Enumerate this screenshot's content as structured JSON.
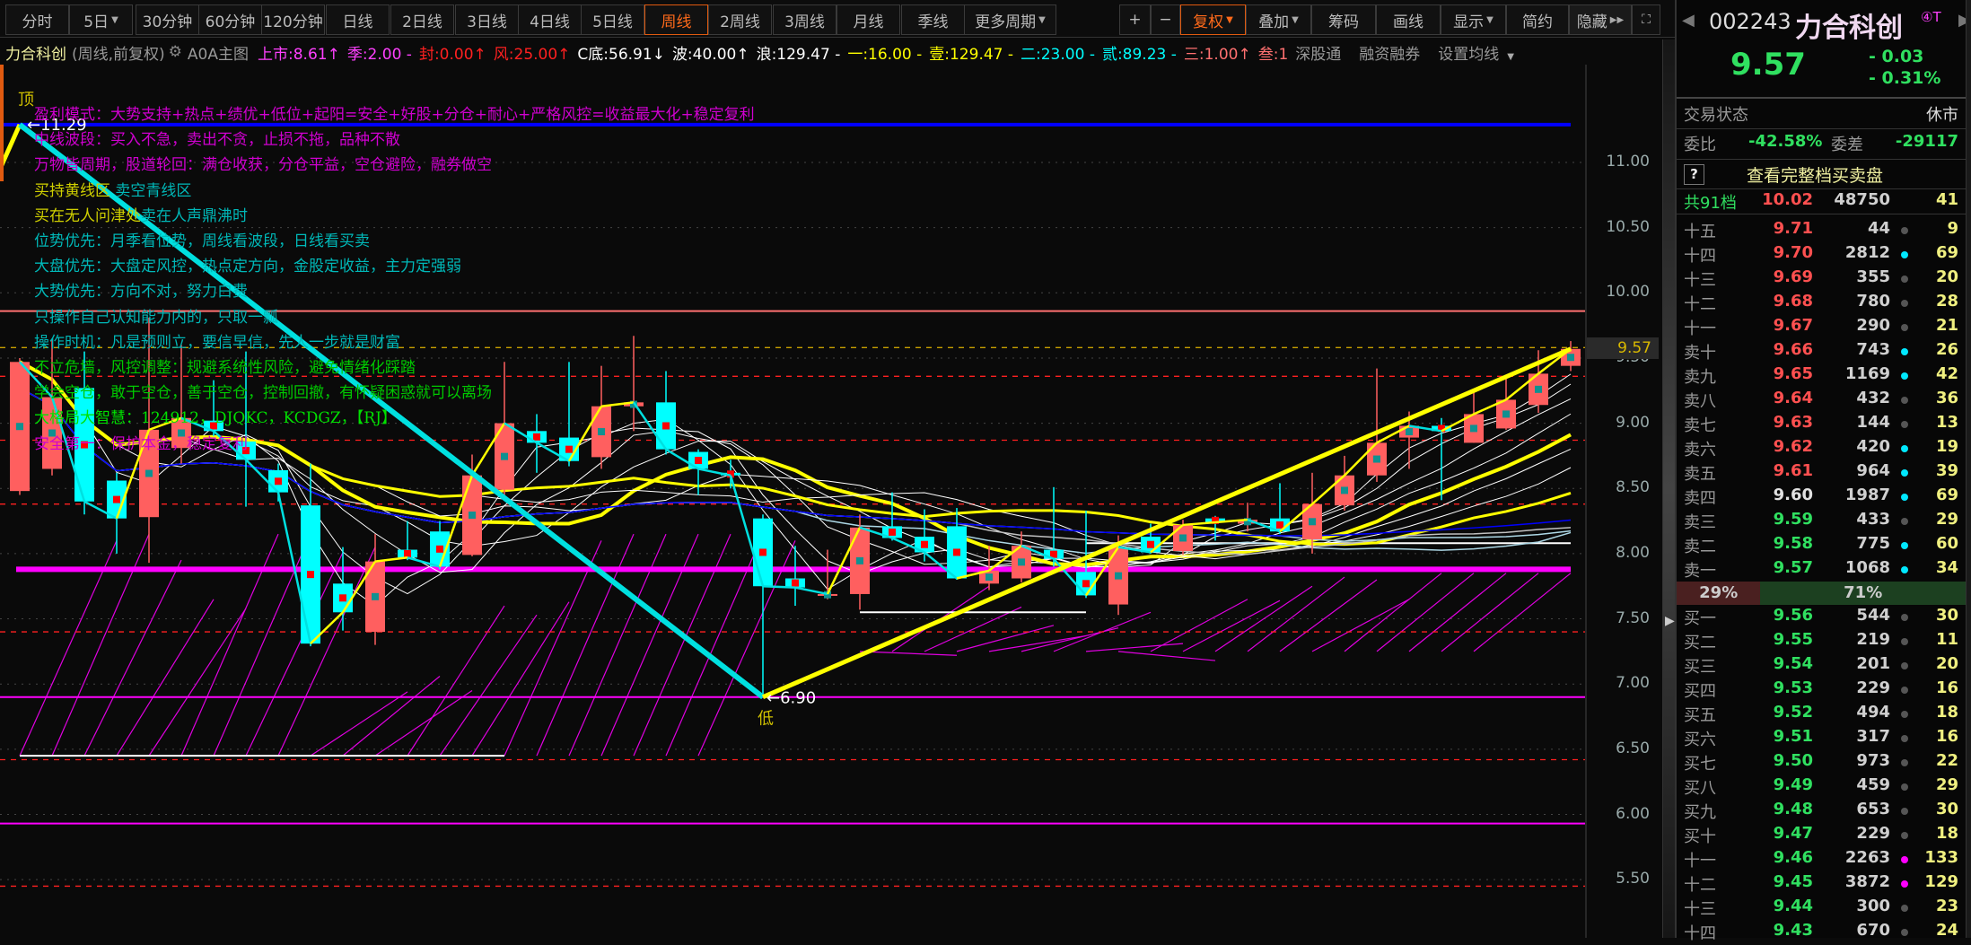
{
  "toolbar": {
    "periods": [
      "分时",
      "5日",
      "30分钟",
      "60分钟",
      "120分钟",
      "日线",
      "2日线",
      "3日线",
      "4日线",
      "5日线",
      "周线",
      "2周线",
      "3周线",
      "月线",
      "季线",
      "更多周期"
    ],
    "active_period": "周线",
    "plus": "+",
    "minus": "−",
    "fuquan": "复权",
    "diejia": "叠加",
    "chouma": "筹码",
    "huaxian": "画线",
    "xianshi": "显示",
    "jianyue": "简约",
    "yincang": "隐藏"
  },
  "info": {
    "name": "力合科创",
    "mode": "(周线,前复权)",
    "main": "A0A主图",
    "items": [
      {
        "text": "上市:8.61↑",
        "color": "#ff40ff"
      },
      {
        "text": "季:2.00 -",
        "color": "#ff40ff"
      },
      {
        "text": "封:0.00↑",
        "color": "#ff2020"
      },
      {
        "text": "风:25.00↑",
        "color": "#ff2020"
      },
      {
        "text": "C底:56.91↓",
        "color": "#ffffff"
      },
      {
        "text": "波:40.00↑",
        "color": "#ffffff"
      },
      {
        "text": "浪:129.47 -",
        "color": "#ffffff"
      },
      {
        "text": "一:16.00 -",
        "color": "#ffff00"
      },
      {
        "text": "壹:129.47 -",
        "color": "#ffff00"
      },
      {
        "text": "二:23.00 -",
        "color": "#00ffff"
      },
      {
        "text": "贰:89.23 -",
        "color": "#00ffff"
      },
      {
        "text": "三:1.00↑",
        "color": "#ff7070"
      },
      {
        "text": "叁:1",
        "color": "#ff7070"
      }
    ],
    "sgt": "深股通",
    "rzrq": "融资融券",
    "ma_setting": "设置均线"
  },
  "annotations": [
    [
      {
        "t": "盈利模式：大势支持+热点+绩优+低位+起阳=安全+好股+分仓+耐心+严格风控=收益最大化+稳定复利",
        "c": "#d000d0"
      }
    ],
    [
      {
        "t": "中线波段：买入不急，卖出不贪，止损不拖，品种不散",
        "c": "#d000d0"
      }
    ],
    [
      {
        "t": "万物皆周期，股道轮回：满仓收获，分仓平益，空仓避险，融券做空",
        "c": "#d000d0"
      }
    ],
    [
      {
        "t": "买持黄线区 ",
        "c": "#d0d000"
      },
      {
        "t": "卖空青线区",
        "c": "#00b8b8"
      }
    ],
    [
      {
        "t": "买在无人问津处",
        "c": "#d0d000"
      },
      {
        "t": "卖在人声鼎沸时",
        "c": "#00b8b8"
      }
    ],
    [
      {
        "t": "位势优先：月季看位势，周线看波段，日线看买卖",
        "c": "#00b8b8"
      }
    ],
    [
      {
        "t": "大盘优先：大盘定风控，热点定方向，金股定收益，主力定强弱",
        "c": "#00b8b8"
      }
    ],
    [
      {
        "t": "大势优先：方向不对，努力白费",
        "c": "#00b8b8"
      }
    ],
    [
      {
        "t": "只操作自己认知能力内的，只取一瓢",
        "c": "#00b8b8"
      }
    ],
    [
      {
        "t": "操作时机：凡是预则立，要信早信，先人一步就是财富",
        "c": "#00b8b8"
      }
    ],
    [
      {
        "t": "不立危墙，风控调整：规避系统性风险，避免情绪化踩踏",
        "c": "#00c800"
      }
    ],
    [
      {
        "t": "学会空仓，敢于空仓，善于空仓，控制回撤，有怀疑困惑就可以离场",
        "c": "#00c800"
      }
    ],
    [
      {
        "t": "大格局大智慧：124912，DJQKC，KCDGZ，【RJ】",
        "c": "#00e000"
      }
    ],
    [
      {
        "t": "安全第一：保护本金，稳定复利",
        "c": "#d000d0"
      }
    ]
  ],
  "chart_data": {
    "type": "candlestick",
    "title": "力合科创(周线,前复权)",
    "ylim": [
      5.2,
      11.6
    ],
    "yticks": [
      "11.00",
      "10.50",
      "10.00",
      "9.50",
      "9.00",
      "8.50",
      "8.00",
      "7.50",
      "7.00",
      "6.50",
      "6.00",
      "5.50"
    ],
    "current_price": "9.57",
    "candles_ohlc": [
      [
        8.48,
        9.5,
        8.45,
        9.47
      ],
      [
        8.65,
        9.64,
        8.6,
        9.2
      ],
      [
        9.27,
        9.55,
        8.3,
        8.4
      ],
      [
        8.56,
        8.62,
        8.0,
        8.27
      ],
      [
        8.28,
        9.81,
        7.93,
        8.95
      ],
      [
        8.81,
        9.6,
        8.69,
        9.04
      ],
      [
        9.02,
        9.33,
        8.9,
        8.94
      ],
      [
        8.86,
        9.55,
        8.36,
        8.72
      ],
      [
        8.64,
        8.69,
        8.4,
        8.47
      ],
      [
        8.37,
        8.69,
        7.29,
        7.31
      ],
      [
        7.77,
        8.05,
        7.41,
        7.55
      ],
      [
        7.4,
        8.15,
        7.3,
        7.94
      ],
      [
        8.03,
        8.25,
        7.95,
        7.97
      ],
      [
        8.17,
        8.25,
        7.88,
        7.9
      ],
      [
        7.99,
        8.76,
        7.98,
        8.6
      ],
      [
        8.49,
        9.47,
        8.45,
        9.0
      ],
      [
        8.94,
        9.07,
        8.62,
        8.85
      ],
      [
        8.89,
        9.47,
        8.67,
        8.71
      ],
      [
        8.74,
        9.44,
        8.65,
        9.13
      ],
      [
        9.13,
        9.67,
        8.94,
        9.16
      ],
      [
        9.16,
        9.4,
        8.76,
        8.8
      ],
      [
        8.78,
        8.8,
        8.45,
        8.65
      ],
      [
        8.62,
        8.72,
        8.5,
        8.6
      ],
      [
        8.27,
        8.3,
        6.9,
        7.75
      ],
      [
        7.81,
        8.06,
        7.6,
        7.74
      ],
      [
        7.68,
        8.03,
        7.65,
        7.69
      ],
      [
        7.69,
        8.3,
        7.57,
        8.2
      ],
      [
        8.21,
        8.47,
        8.1,
        8.12
      ],
      [
        8.13,
        8.34,
        7.94,
        8.01
      ],
      [
        8.21,
        8.35,
        7.8,
        7.81
      ],
      [
        7.77,
        8.06,
        7.72,
        7.87
      ],
      [
        7.81,
        8.17,
        7.78,
        8.06
      ],
      [
        8.03,
        8.51,
        7.9,
        7.96
      ],
      [
        7.86,
        8.33,
        7.66,
        7.68
      ],
      [
        7.61,
        8.14,
        7.53,
        8.05
      ],
      [
        8.13,
        8.23,
        8.0,
        8.01
      ],
      [
        8.02,
        8.26,
        7.99,
        8.22
      ],
      [
        8.27,
        8.29,
        8.1,
        8.24
      ],
      [
        8.23,
        8.39,
        8.17,
        8.26
      ],
      [
        8.27,
        8.54,
        8.15,
        8.17
      ],
      [
        8.11,
        8.62,
        8.0,
        8.38
      ],
      [
        8.37,
        8.75,
        8.33,
        8.6
      ],
      [
        8.6,
        9.42,
        8.55,
        8.85
      ],
      [
        8.89,
        9.09,
        8.65,
        8.98
      ],
      [
        8.98,
        9.04,
        8.41,
        8.94
      ],
      [
        8.85,
        9.25,
        8.85,
        9.07
      ],
      [
        8.96,
        9.36,
        8.95,
        9.18
      ],
      [
        9.14,
        9.56,
        9.08,
        9.38
      ],
      [
        9.44,
        9.63,
        9.4,
        9.57
      ]
    ],
    "ref_lines": [
      {
        "price": 11.29,
        "color": "#0000ff",
        "style": "solid"
      },
      {
        "price": 9.86,
        "color": "#ff7070",
        "style": "solid"
      },
      {
        "price": 9.58,
        "color": "#c8a000",
        "style": "dashed"
      },
      {
        "price": 9.36,
        "color": "#ff2020",
        "style": "dashed"
      },
      {
        "price": 8.87,
        "color": "#ff2020",
        "style": "dashed"
      },
      {
        "price": 8.38,
        "color": "#ff2020",
        "style": "dashed"
      },
      {
        "price": 7.88,
        "color": "#ff00ff",
        "style": "thick"
      },
      {
        "price": 7.4,
        "color": "#ff2020",
        "style": "dashed"
      },
      {
        "price": 6.9,
        "color": "#ff00ff",
        "style": "solid"
      },
      {
        "price": 6.42,
        "color": "#ff2020",
        "style": "dashed"
      },
      {
        "price": 5.93,
        "color": "#ff00ff",
        "style": "solid"
      },
      {
        "price": 5.45,
        "color": "#ff2020",
        "style": "dashed"
      }
    ],
    "zigzag": [
      {
        "index": 0,
        "price": 11.29
      },
      {
        "index": 23,
        "price": 6.9
      },
      {
        "index": 48,
        "price": 9.57
      }
    ],
    "top_label": "顶",
    "top_value": "←11.29",
    "low_label": "低",
    "low_value": "←6.90"
  },
  "panel": {
    "code": "002243",
    "name": "力合科创",
    "badge": "④T",
    "price": "9.57",
    "change": "- 0.03",
    "pct": "- 0.31%",
    "status_label": "交易状态",
    "status_value": "休市",
    "wb_label": "委比",
    "wb_value": "-42.58%",
    "wc_label": "委差",
    "wc_value": "-29117",
    "help": "?",
    "full_book": "查看完整档买卖盘",
    "summary": {
      "label": "共91档",
      "price": "10.02",
      "vol": "48750",
      "count": "41"
    },
    "asks": [
      [
        "十五",
        "9.71",
        "44",
        "#555",
        "9"
      ],
      [
        "十四",
        "9.70",
        "2812",
        "#00e8ff",
        "69"
      ],
      [
        "十三",
        "9.69",
        "355",
        "#555",
        "20"
      ],
      [
        "十二",
        "9.68",
        "780",
        "#555",
        "28"
      ],
      [
        "十一",
        "9.67",
        "290",
        "#555",
        "21"
      ],
      [
        "卖十",
        "9.66",
        "743",
        "#00e8ff",
        "26"
      ],
      [
        "卖九",
        "9.65",
        "1169",
        "#00e8ff",
        "42"
      ],
      [
        "卖八",
        "9.64",
        "432",
        "#555",
        "36"
      ],
      [
        "卖七",
        "9.63",
        "144",
        "#555",
        "13"
      ],
      [
        "卖六",
        "9.62",
        "420",
        "#00e8ff",
        "19"
      ],
      [
        "卖五",
        "9.61",
        "964",
        "#00e8ff",
        "39"
      ],
      [
        "卖四",
        "9.60",
        "1987",
        "#00e8ff",
        "69"
      ],
      [
        "卖三",
        "9.59",
        "433",
        "#555",
        "29"
      ],
      [
        "卖二",
        "9.58",
        "775",
        "#00e8ff",
        "60"
      ],
      [
        "卖一",
        "9.57",
        "1068",
        "#00e8ff",
        "34"
      ]
    ],
    "bar": {
      "buy_pct": "29%",
      "sell_pct": "71%",
      "buy_ratio": 0.29
    },
    "bids": [
      [
        "买一",
        "9.56",
        "544",
        "#555",
        "30"
      ],
      [
        "买二",
        "9.55",
        "219",
        "#555",
        "11"
      ],
      [
        "买三",
        "9.54",
        "201",
        "#555",
        "20"
      ],
      [
        "买四",
        "9.53",
        "229",
        "#555",
        "16"
      ],
      [
        "买五",
        "9.52",
        "494",
        "#555",
        "18"
      ],
      [
        "买六",
        "9.51",
        "317",
        "#555",
        "16"
      ],
      [
        "买七",
        "9.50",
        "973",
        "#555",
        "22"
      ],
      [
        "买八",
        "9.49",
        "459",
        "#555",
        "29"
      ],
      [
        "买九",
        "9.48",
        "653",
        "#555",
        "30"
      ],
      [
        "买十",
        "9.47",
        "229",
        "#555",
        "18"
      ],
      [
        "十一",
        "9.46",
        "2263",
        "#ff00ff",
        "133"
      ],
      [
        "十二",
        "9.45",
        "3872",
        "#ff00ff",
        "129"
      ],
      [
        "十三",
        "9.44",
        "300",
        "#555",
        "23"
      ],
      [
        "十四",
        "9.43",
        "670",
        "#555",
        "24"
      ]
    ],
    "colors": {
      "up": "#ff5050",
      "down": "#30e060",
      "flat": "#e0e0e0"
    }
  }
}
